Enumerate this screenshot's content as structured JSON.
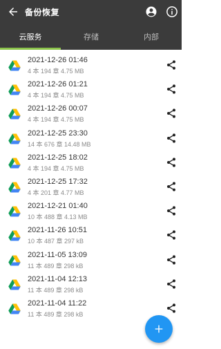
{
  "app": {
    "title": "备份恢复"
  },
  "toolbar": {
    "back_icon": "arrow-left-icon",
    "account_icon": "account-circle-icon",
    "info_icon": "info-icon"
  },
  "tabs": [
    {
      "label": "云服务",
      "active": true
    },
    {
      "label": "存储",
      "active": false
    },
    {
      "label": "内部",
      "active": false
    }
  ],
  "backups": [
    {
      "date": "2021-12-26 01:46",
      "meta": "4 本 194 章  4.75 MB"
    },
    {
      "date": "2021-12-26 01:21",
      "meta": "4 本 194 章  4.75 MB"
    },
    {
      "date": "2021-12-26 00:07",
      "meta": "4 本 194 章  4.75 MB"
    },
    {
      "date": "2021-12-25 23:30",
      "meta": "14 本 676 章  14.48 MB"
    },
    {
      "date": "2021-12-25 18:02",
      "meta": "4 本 194 章  4.75 MB"
    },
    {
      "date": "2021-12-25 17:32",
      "meta": "4 本 201 章  4.77 MB"
    },
    {
      "date": "2021-12-21 01:40",
      "meta": "10 本 488 章  4.13 MB"
    },
    {
      "date": "2021-11-26 10:51",
      "meta": "10 本 487 章  297 kB"
    },
    {
      "date": "2021-11-05 13:09",
      "meta": "11 本 489 章  298 kB"
    },
    {
      "date": "2021-11-04 12:13",
      "meta": "11 本 489 章  298 kB"
    },
    {
      "date": "2021-11-04 11:22",
      "meta": "11 本 489 章  298 kB"
    }
  ],
  "colors": {
    "appbar": "#3b3b3b",
    "tab_indicator": "#8bc34a",
    "fab": "#2196f3"
  },
  "fab": {
    "icon": "plus-icon"
  }
}
